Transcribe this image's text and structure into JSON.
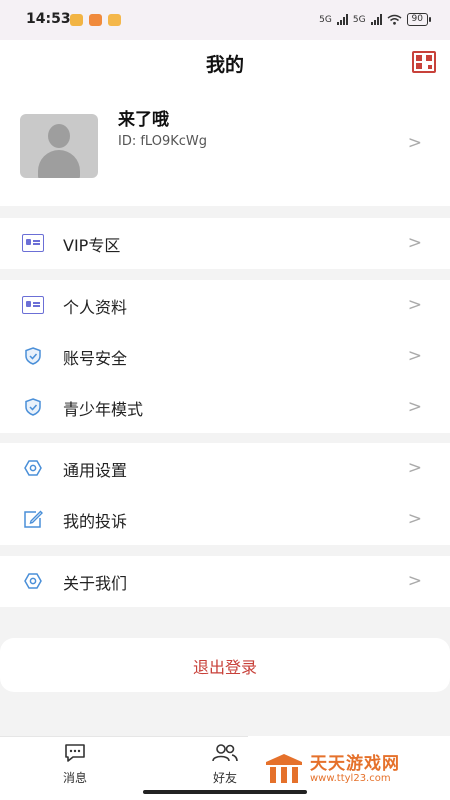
{
  "status_bar": {
    "time": "14:53",
    "network_1": "5G",
    "network_2": "5G",
    "battery": "90"
  },
  "header": {
    "title": "我的"
  },
  "profile": {
    "name": "来了哦",
    "id_text": "ID: fLO9KcWg"
  },
  "menu": {
    "group1": [
      {
        "label": "VIP专区",
        "icon": "id-card-icon"
      }
    ],
    "group2": [
      {
        "label": "个人资料",
        "icon": "id-card-icon"
      },
      {
        "label": "账号安全",
        "icon": "shield-icon"
      },
      {
        "label": "青少年模式",
        "icon": "shield-icon"
      }
    ],
    "group3": [
      {
        "label": "通用设置",
        "icon": "gear-icon"
      },
      {
        "label": "我的投诉",
        "icon": "edit-icon"
      }
    ],
    "group4": [
      {
        "label": "关于我们",
        "icon": "gear-icon"
      }
    ],
    "chevron": ">"
  },
  "logout": {
    "label": "退出登录"
  },
  "tabbar": {
    "messages": "消息",
    "friends": "好友"
  },
  "watermark": {
    "title": "天天游戏网",
    "url": "www.ttyl23.com"
  },
  "colors": {
    "accent_red": "#c8413a",
    "icon_blue": "#4a8fd8",
    "icon_purple": "#6b6fd6",
    "watermark_orange": "#e5712b"
  }
}
